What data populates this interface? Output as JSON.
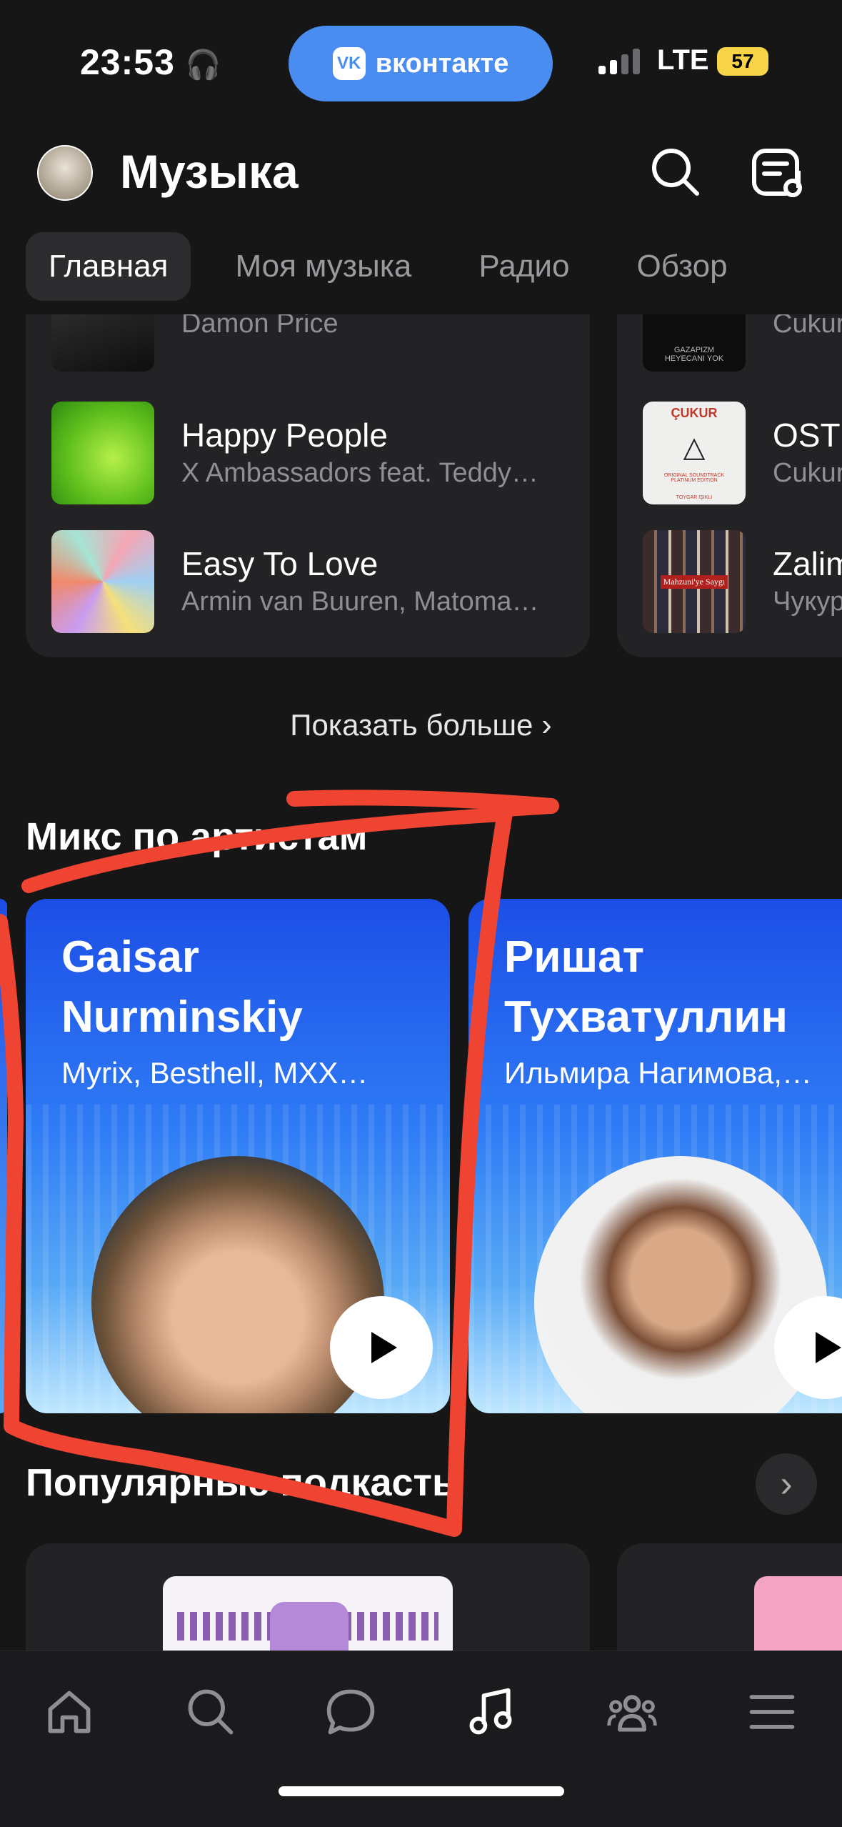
{
  "status_bar": {
    "time": "23:53",
    "pill_label": "вконтакте",
    "network": "LTE",
    "battery": "57"
  },
  "header": {
    "title": "Музыка"
  },
  "tabs": [
    "Главная",
    "Моя музыка",
    "Радио",
    "Обзор"
  ],
  "tracks_left": [
    {
      "title": "",
      "artist": "Damon Price"
    },
    {
      "title": "Happy People",
      "artist": "X Ambassadors feat. Teddy…"
    },
    {
      "title": "Easy To Love",
      "artist": "Armin van Buuren, Matoma…"
    }
  ],
  "tracks_right": [
    {
      "title": "",
      "artist": "Cukur"
    },
    {
      "title": "OST",
      "artist": "Cukur"
    },
    {
      "title": "Zalim",
      "artist": "Чукур"
    }
  ],
  "cover_texts": {
    "gazapizm": "GAZAPIZM HEYECANI YOK",
    "cukur": "ÇUKUR",
    "cukur_sub": "ORIGINAL SOUNDTRACK PLATINUM EDITION",
    "cukur_author": "TOYGAR IŞIKLI",
    "mahzuni": "Mahzuni'ye Saygı"
  },
  "show_more": "Показать больше",
  "mix_section": {
    "title": "Микс по артистам"
  },
  "mixes": [
    {
      "name_line1": "Gaisar",
      "name_line2": "Nurminskiy",
      "artists": "Myrix, Besthell, MXX…"
    },
    {
      "name_line1": "Ришат",
      "name_line2": "Тухватуллин",
      "artists": "Ильмира Нагимова,…"
    }
  ],
  "popular_section": {
    "title": "Популярные подкасты"
  },
  "nav": [
    "home-icon",
    "search-icon",
    "messages-icon",
    "music-icon",
    "friends-icon",
    "menu-icon"
  ],
  "colors": {
    "background": "#161617",
    "card": "#232325",
    "accent": "#4a8df0",
    "annotation": "#f04432"
  }
}
